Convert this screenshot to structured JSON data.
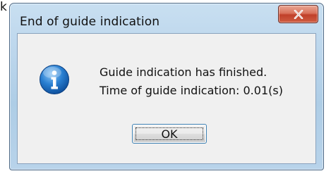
{
  "background": {
    "partial_char": "k"
  },
  "dialog": {
    "title": "End of guide indication",
    "close_icon": "close-x-icon",
    "message_icon": "information-icon",
    "message_line1": "Guide indication has finished.",
    "message_line2": "Time of guide indication: 0.01(s)",
    "ok_label": "OK"
  },
  "colors": {
    "title_bar": "#bcd6ec",
    "close_button": "#c8452d",
    "content_bg": "#f0f0f0",
    "info_icon": "#1f6fc4"
  }
}
